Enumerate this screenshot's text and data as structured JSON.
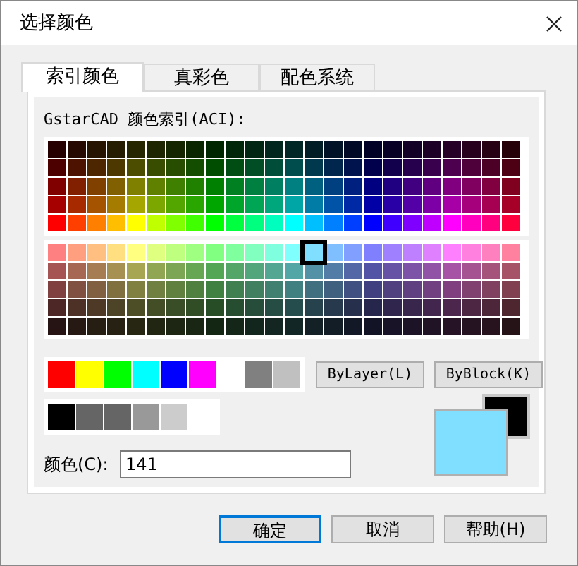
{
  "window": {
    "title": "选择颜色"
  },
  "tabs": [
    {
      "label": "索引颜色",
      "selected": true
    },
    {
      "label": "真彩色",
      "selected": false
    },
    {
      "label": "配色系统",
      "selected": false
    }
  ],
  "index_tab": {
    "label": "GstarCAD 颜色索引(ACI):",
    "grid": {
      "hues": [
        {
          "color": "#ff0000",
          "selected": false
        },
        {
          "color": "#ff3f00",
          "selected": false
        },
        {
          "color": "#ff7f00",
          "selected": false
        },
        {
          "color": "#ffbf00",
          "selected": false
        },
        {
          "color": "#ffff00",
          "selected": false
        },
        {
          "color": "#bfff00",
          "selected": false
        },
        {
          "color": "#7fff00",
          "selected": false
        },
        {
          "color": "#3fff00",
          "selected": false
        },
        {
          "color": "#00ff00",
          "selected": false
        },
        {
          "color": "#00ff3f",
          "selected": false
        },
        {
          "color": "#00ff7f",
          "selected": false
        },
        {
          "color": "#00ffbf",
          "selected": false
        },
        {
          "color": "#00ffff",
          "selected": false
        },
        {
          "color": "#00bfff",
          "selected": true
        },
        {
          "color": "#007fff",
          "selected": false
        },
        {
          "color": "#003fff",
          "selected": false
        },
        {
          "color": "#0000ff",
          "selected": false
        },
        {
          "color": "#3f00ff",
          "selected": false
        },
        {
          "color": "#7f00ff",
          "selected": false
        },
        {
          "color": "#bf00ff",
          "selected": false
        },
        {
          "color": "#ff00ff",
          "selected": false
        },
        {
          "color": "#ff00bf",
          "selected": false
        },
        {
          "color": "#ff007f",
          "selected": false
        },
        {
          "color": "#ff003f",
          "selected": false
        }
      ],
      "rows": [
        {
          "selected": false
        },
        {
          "selected": false
        },
        {
          "selected": false
        },
        {
          "selected": false
        },
        {
          "selected": false
        },
        {
          "selected": true
        },
        {
          "selected": false
        },
        {
          "selected": false
        },
        {
          "selected": false
        },
        {
          "selected": false
        }
      ]
    },
    "standard_colors": [
      {
        "kind": "standard",
        "color": "#ff0000"
      },
      {
        "kind": "standard",
        "color": "#ffff00"
      },
      {
        "kind": "standard",
        "color": "#00ff00"
      },
      {
        "kind": "standard",
        "color": "#00ffff"
      },
      {
        "kind": "standard",
        "color": "#0000ff"
      },
      {
        "kind": "standard",
        "color": "#ff00ff"
      },
      {
        "kind": "gray",
        "color": "#808080"
      },
      {
        "kind": "gray",
        "color": "#c0c0c0"
      }
    ],
    "gray_colors": [
      {
        "color": "#000000"
      },
      {
        "color": "#656565"
      },
      {
        "color": "#656565"
      },
      {
        "color": "#999999"
      },
      {
        "color": "#cccccc"
      }
    ],
    "buttons": [
      {
        "label": "ByLayer(L)"
      },
      {
        "label": "ByBlock(K)"
      }
    ],
    "color_field": {
      "label": "颜色(C):",
      "value": "141"
    },
    "preview": [
      {
        "kind": "new",
        "color": "#80dfff"
      },
      {
        "kind": "old",
        "color": "#000000"
      }
    ]
  },
  "dialog_buttons": [
    {
      "label": "确定",
      "default": true
    },
    {
      "label": "取消",
      "default": false
    },
    {
      "label": "帮助(H)",
      "default": false
    }
  ]
}
